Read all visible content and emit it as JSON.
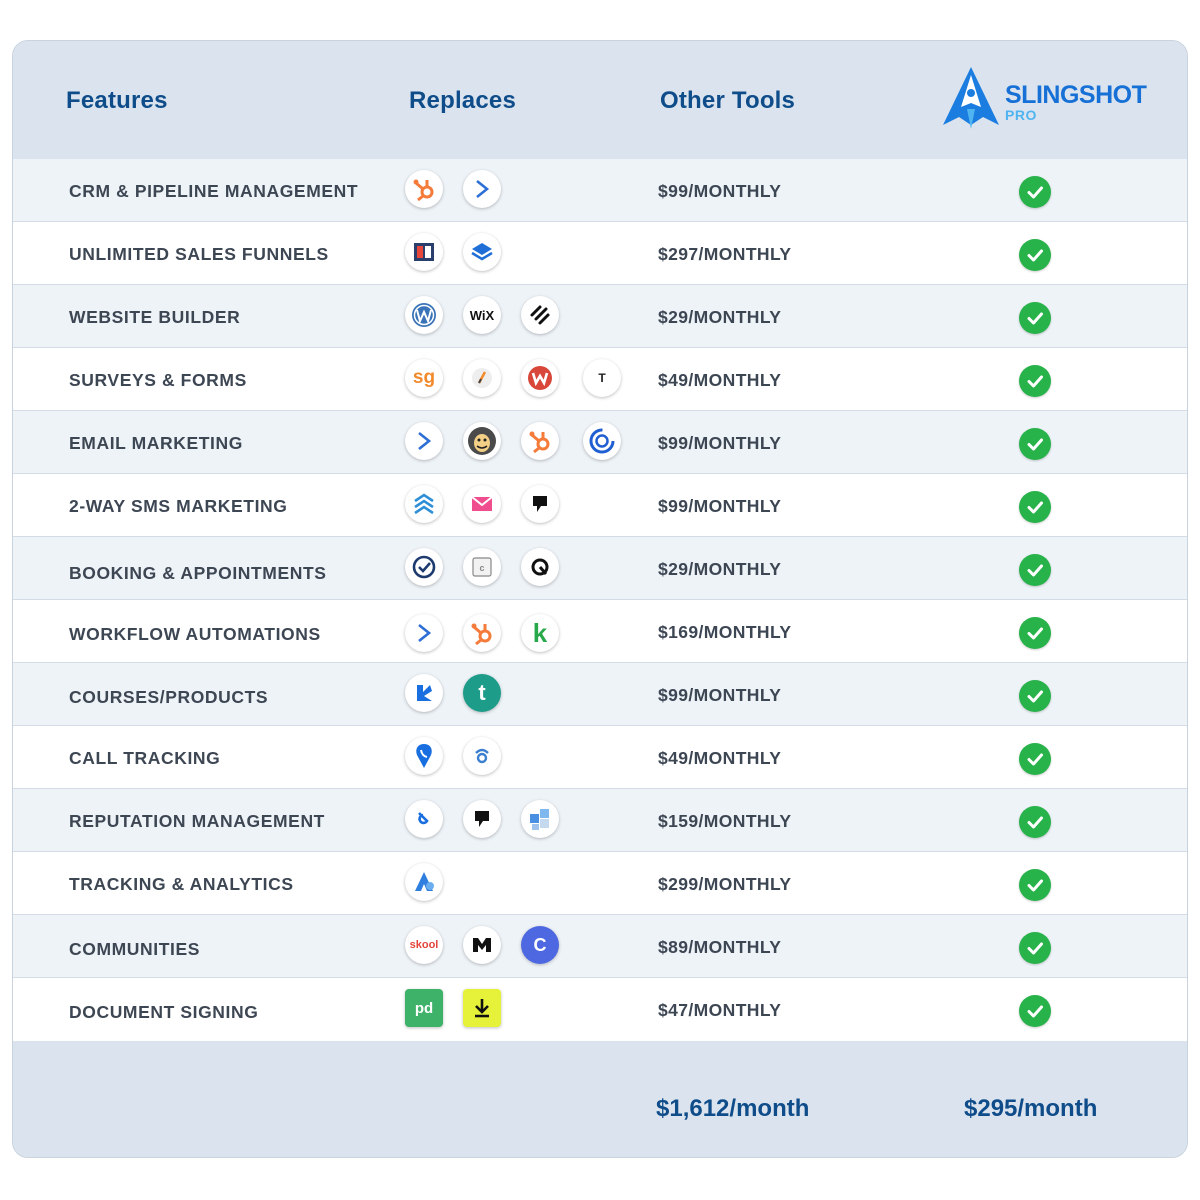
{
  "header": {
    "features": "Features",
    "replaces": "Replaces",
    "other_tools": "Other Tools",
    "brand": "SLINGSHOT",
    "brand_sub": "PRO"
  },
  "colors": {
    "heading": "#0f4c8a",
    "check": "#27b24a",
    "brand": "#1670d6"
  },
  "rows": [
    {
      "feature": "CRM & PIPELINE MANAGEMENT",
      "price": "$99/MONTHLY",
      "icons": [
        "hubspot-icon",
        "activecampaign-icon"
      ]
    },
    {
      "feature": "UNLIMITED SALES FUNNELS",
      "price": "$297/MONTHLY",
      "icons": [
        "clickfunnels-icon",
        "layers-icon"
      ]
    },
    {
      "feature": "WEBSITE BUILDER",
      "price": "$29/MONTHLY",
      "icons": [
        "wordpress-icon",
        "wix-icon",
        "squarespace-icon"
      ]
    },
    {
      "feature": "SURVEYS & FORMS",
      "price": "$49/MONTHLY",
      "icons": [
        "surveygizmo-icon",
        "jotform-icon",
        "wufoo-icon",
        "typeform-icon"
      ]
    },
    {
      "feature": "EMAIL MARKETING",
      "price": "$99/MONTHLY",
      "icons": [
        "activecampaign-icon",
        "mailchimp-icon",
        "hubspot-icon",
        "constantcontact-icon"
      ]
    },
    {
      "feature": "2-WAY SMS MARKETING",
      "price": "$99/MONTHLY",
      "icons": [
        "chevrons-icon",
        "envelope-icon",
        "podium-icon"
      ]
    },
    {
      "feature": "BOOKING & APPOINTMENTS",
      "price": "$29/MONTHLY",
      "icons": [
        "calendly-icon",
        "calendar-icon",
        "acuity-icon"
      ]
    },
    {
      "feature": "WORKFLOW AUTOMATIONS",
      "price": "$169/MONTHLY",
      "icons": [
        "activecampaign-icon",
        "hubspot-icon",
        "keap-icon"
      ]
    },
    {
      "feature": "COURSES/PRODUCTS",
      "price": "$99/MONTHLY",
      "icons": [
        "kajabi-icon",
        "teachable-icon"
      ]
    },
    {
      "feature": "CALL TRACKING",
      "price": "$49/MONTHLY",
      "icons": [
        "callrail-icon",
        "signal-icon"
      ]
    },
    {
      "feature": "REPUTATION MANAGEMENT",
      "price": "$159/MONTHLY",
      "icons": [
        "birdeye-icon",
        "podium-icon",
        "puzzle-icon"
      ]
    },
    {
      "feature": "TRACKING & ANALYTICS",
      "price": "$299/MONTHLY",
      "icons": [
        "analytics-icon"
      ]
    },
    {
      "feature": "COMMUNITIES",
      "price": "$89/MONTHLY",
      "icons": [
        "skool-icon",
        "mighty-icon",
        "circle-icon"
      ]
    },
    {
      "feature": "DOCUMENT SIGNING",
      "price": "$47/MONTHLY",
      "icons": [
        "pandadoc-icon",
        "download-icon"
      ]
    }
  ],
  "icon_text": {
    "wix": "WiX",
    "surveygizmo": "sg",
    "typeform": "T",
    "teachable": "t",
    "skool": "skool",
    "circle": "C",
    "pandadoc": "pd",
    "keap": "k"
  },
  "footer": {
    "other_total": "$1,612/month",
    "slingshot_total": "$295/month"
  }
}
